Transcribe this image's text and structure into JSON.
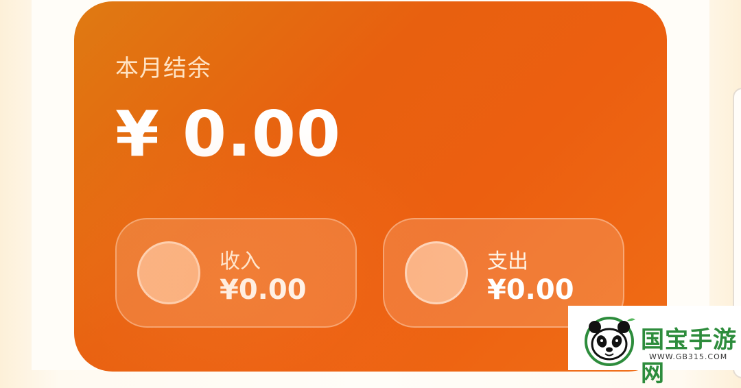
{
  "balance_card": {
    "label": "本月结余",
    "amount": "¥ 0.00"
  },
  "income": {
    "title": "收入",
    "value": "¥0.00",
    "icon": "income-icon"
  },
  "expense": {
    "title": "支出",
    "value": "¥0.00",
    "icon": "expense-icon"
  },
  "watermark": {
    "brand": "国宝手游网",
    "url": "WWW.GB315.COM"
  },
  "colors": {
    "card_gradient_start": "#df7a12",
    "card_gradient_end": "#f06d16",
    "text_primary": "#ffffff",
    "text_muted": "#ffe3c4",
    "watermark_green": "#2d8c3c"
  }
}
